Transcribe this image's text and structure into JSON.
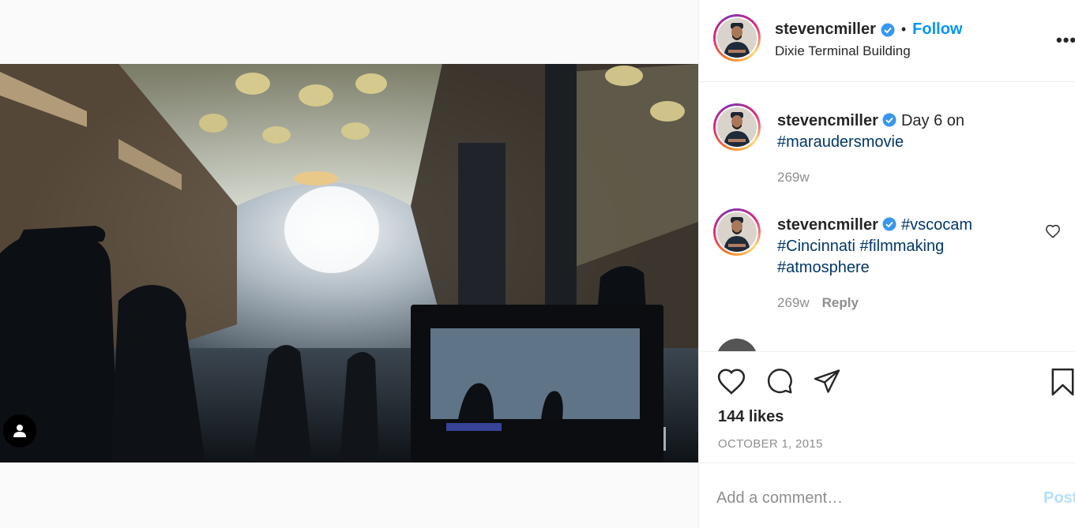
{
  "post": {
    "username": "stevencmiller",
    "separator": "•",
    "follow_label": "Follow",
    "location": "Dixie Terminal Building",
    "more_label": "•••"
  },
  "comments": [
    {
      "username": "stevencmiller",
      "text_plain": "Day 6 on",
      "hashtags_line": "#maraudersmovie",
      "age": "269w"
    },
    {
      "username": "stevencmiller",
      "hashtag_1": "#vscocam",
      "hashtags_line2": "#Cincinnati #filmmaking",
      "hashtags_line3": "#atmosphere",
      "age": "269w",
      "reply_label": "Reply"
    }
  ],
  "actions": {
    "likes": "144 likes",
    "date": "OCTOBER 1, 2015"
  },
  "comment_box": {
    "placeholder": "Add a comment…",
    "post_label": "Post"
  },
  "colors": {
    "link_blue": "#0095f6",
    "hashtag": "#00376b",
    "verified": "#3897f0"
  },
  "icons": {
    "verified": "verified-badge-icon",
    "like": "heart-icon",
    "comment": "comment-bubble-icon",
    "share": "paper-plane-icon",
    "save": "bookmark-icon",
    "tag": "user-tag-icon"
  }
}
